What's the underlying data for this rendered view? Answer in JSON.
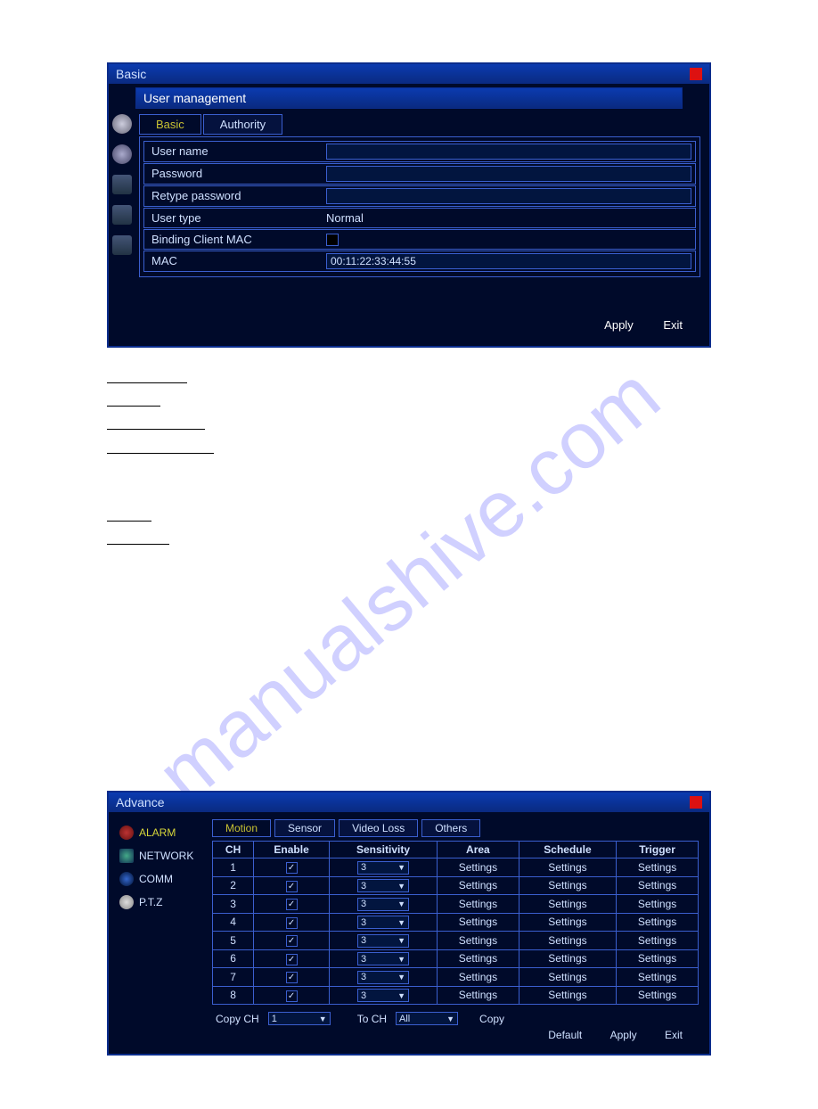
{
  "watermark_text": "manualshive.com",
  "window1": {
    "title": "Basic",
    "inner_title": "User management",
    "tabs": [
      {
        "label": "Basic",
        "active": true
      },
      {
        "label": "Authority",
        "active": false
      }
    ],
    "fields": {
      "username_label": "User name",
      "username_value": "",
      "password_label": "Password",
      "password_value": "",
      "retype_label": "Retype password",
      "retype_value": "",
      "usertype_label": "User type",
      "usertype_value": "Normal",
      "binding_label": "Binding Client MAC",
      "binding_checked": false,
      "mac_label": "MAC",
      "mac_value": "00:11:22:33:44:55"
    },
    "buttons": {
      "apply": "Apply",
      "exit": "Exit"
    }
  },
  "window2": {
    "title": "Advance",
    "nav": [
      {
        "label": "ALARM",
        "active": true,
        "icon": "alarm"
      },
      {
        "label": "NETWORK",
        "active": false,
        "icon": "net"
      },
      {
        "label": "COMM",
        "active": false,
        "icon": "at"
      },
      {
        "label": "P.T.Z",
        "active": false,
        "icon": "ptz"
      }
    ],
    "tabs": [
      {
        "label": "Motion",
        "active": true
      },
      {
        "label": "Sensor",
        "active": false
      },
      {
        "label": "Video Loss",
        "active": false
      },
      {
        "label": "Others",
        "active": false
      }
    ],
    "table": {
      "headers": [
        "CH",
        "Enable",
        "Sensitivity",
        "Area",
        "Schedule",
        "Trigger"
      ],
      "rows": [
        {
          "ch": "1",
          "enable": true,
          "sensitivity": "3",
          "area": "Settings",
          "schedule": "Settings",
          "trigger": "Settings"
        },
        {
          "ch": "2",
          "enable": true,
          "sensitivity": "3",
          "area": "Settings",
          "schedule": "Settings",
          "trigger": "Settings"
        },
        {
          "ch": "3",
          "enable": true,
          "sensitivity": "3",
          "area": "Settings",
          "schedule": "Settings",
          "trigger": "Settings"
        },
        {
          "ch": "4",
          "enable": true,
          "sensitivity": "3",
          "area": "Settings",
          "schedule": "Settings",
          "trigger": "Settings"
        },
        {
          "ch": "5",
          "enable": true,
          "sensitivity": "3",
          "area": "Settings",
          "schedule": "Settings",
          "trigger": "Settings"
        },
        {
          "ch": "6",
          "enable": true,
          "sensitivity": "3",
          "area": "Settings",
          "schedule": "Settings",
          "trigger": "Settings"
        },
        {
          "ch": "7",
          "enable": true,
          "sensitivity": "3",
          "area": "Settings",
          "schedule": "Settings",
          "trigger": "Settings"
        },
        {
          "ch": "8",
          "enable": true,
          "sensitivity": "3",
          "area": "Settings",
          "schedule": "Settings",
          "trigger": "Settings"
        }
      ]
    },
    "copyrow": {
      "copy_ch_label": "Copy CH",
      "copy_ch_value": "1",
      "to_ch_label": "To CH",
      "to_ch_value": "All",
      "copy_btn": "Copy"
    },
    "buttons": {
      "default": "Default",
      "apply": "Apply",
      "exit": "Exit"
    }
  }
}
